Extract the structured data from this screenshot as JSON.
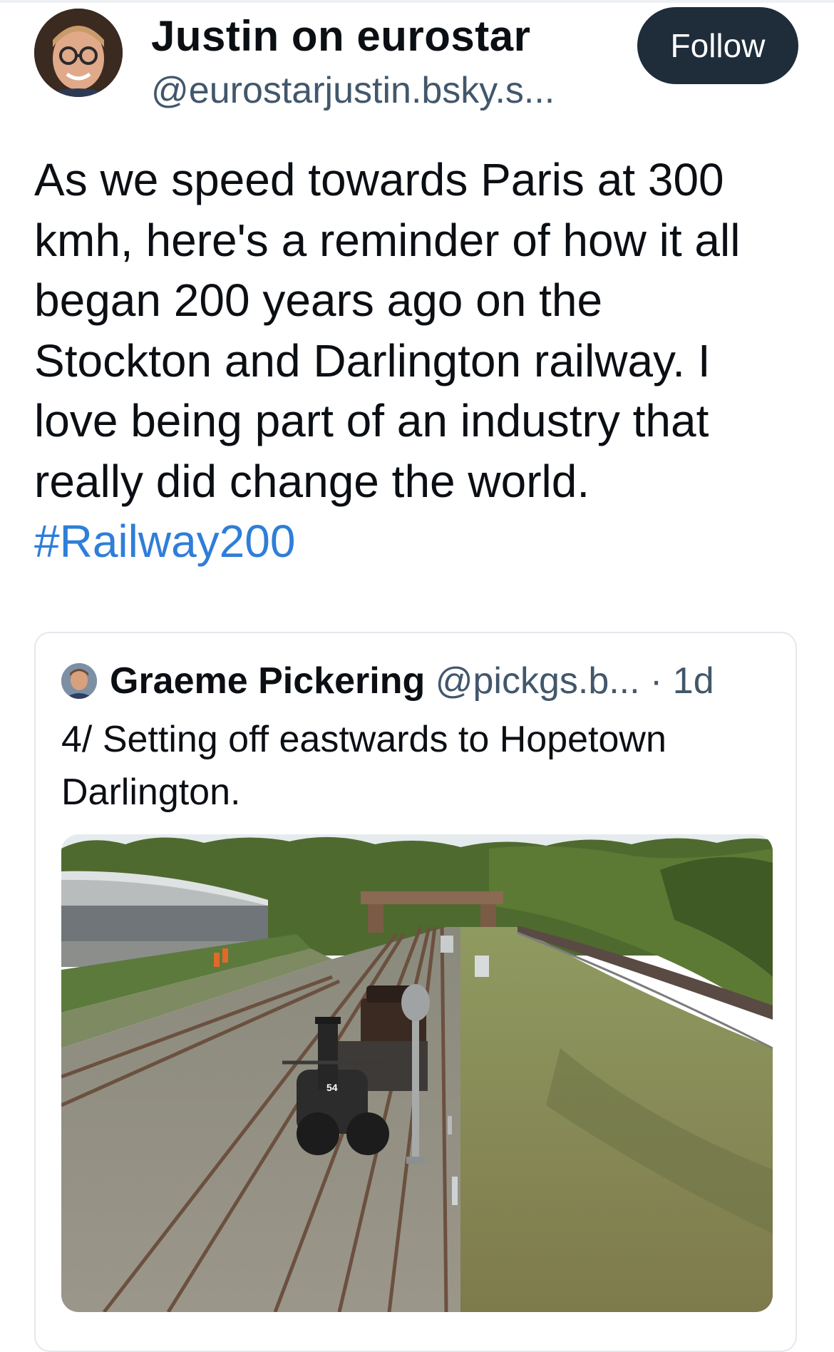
{
  "post": {
    "author_name": "Justin on eurostar",
    "author_handle": "@eurostarjustin.bsky.s...",
    "follow_label": "Follow",
    "text": "As we speed towards Paris at 300\nkmh, here's a reminder of how it all\nbegan 200 years ago on the\nStockton and Darlington railway. I\nlove being part of an industry that\nreally did change the world.",
    "hashtag": "#Railway200"
  },
  "quote": {
    "author_name": "Graeme Pickering",
    "author_handle": "@pickgs.b...",
    "time": "· 1d",
    "text": "4/ Setting off eastwards to Hopetown Darlington.",
    "engine_number": "54"
  },
  "colors": {
    "link": "#2f7ed8",
    "follow_bg": "#1f2c3a",
    "secondary_text": "#42576c"
  }
}
